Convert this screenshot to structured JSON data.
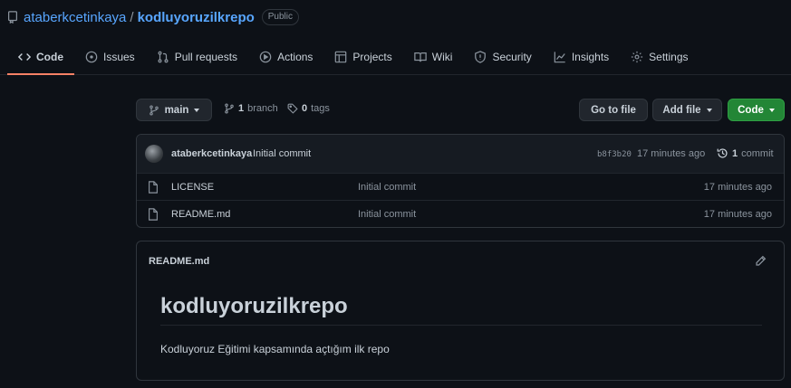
{
  "repo": {
    "owner": "ataberkcetinkaya",
    "separator": "/",
    "name": "kodluyoruzilkrepo",
    "visibility": "Public"
  },
  "tabs": [
    {
      "label": "Code",
      "icon": "code-icon",
      "active": true
    },
    {
      "label": "Issues",
      "icon": "issue-icon"
    },
    {
      "label": "Pull requests",
      "icon": "pull-request-icon"
    },
    {
      "label": "Actions",
      "icon": "play-icon"
    },
    {
      "label": "Projects",
      "icon": "table-icon"
    },
    {
      "label": "Wiki",
      "icon": "book-icon"
    },
    {
      "label": "Security",
      "icon": "shield-icon"
    },
    {
      "label": "Insights",
      "icon": "graph-icon"
    },
    {
      "label": "Settings",
      "icon": "gear-icon"
    }
  ],
  "toolbar": {
    "branch": "main",
    "branch_count": "1",
    "branch_label": "branch",
    "tag_count": "0",
    "tag_label": "tags",
    "go_to_file": "Go to file",
    "add_file": "Add file",
    "code": "Code"
  },
  "latest_commit": {
    "author": "ataberkcetinkaya",
    "message": "Initial commit",
    "sha": "b8f3b20",
    "time": "17 minutes ago",
    "count": "1",
    "count_label": "commit"
  },
  "files": [
    {
      "name": "LICENSE",
      "commit": "Initial commit",
      "age": "17 minutes ago"
    },
    {
      "name": "README.md",
      "commit": "Initial commit",
      "age": "17 minutes ago"
    }
  ],
  "readme": {
    "filename": "README.md",
    "heading": "kodluyoruzilkrepo",
    "paragraph": "Kodluyoruz Eğitimi kapsamında açtığım ilk repo"
  },
  "colors": {
    "background": "#0d1117",
    "link": "#58a6ff",
    "active_tab_underline": "#f78166",
    "code_button": "#238636"
  }
}
